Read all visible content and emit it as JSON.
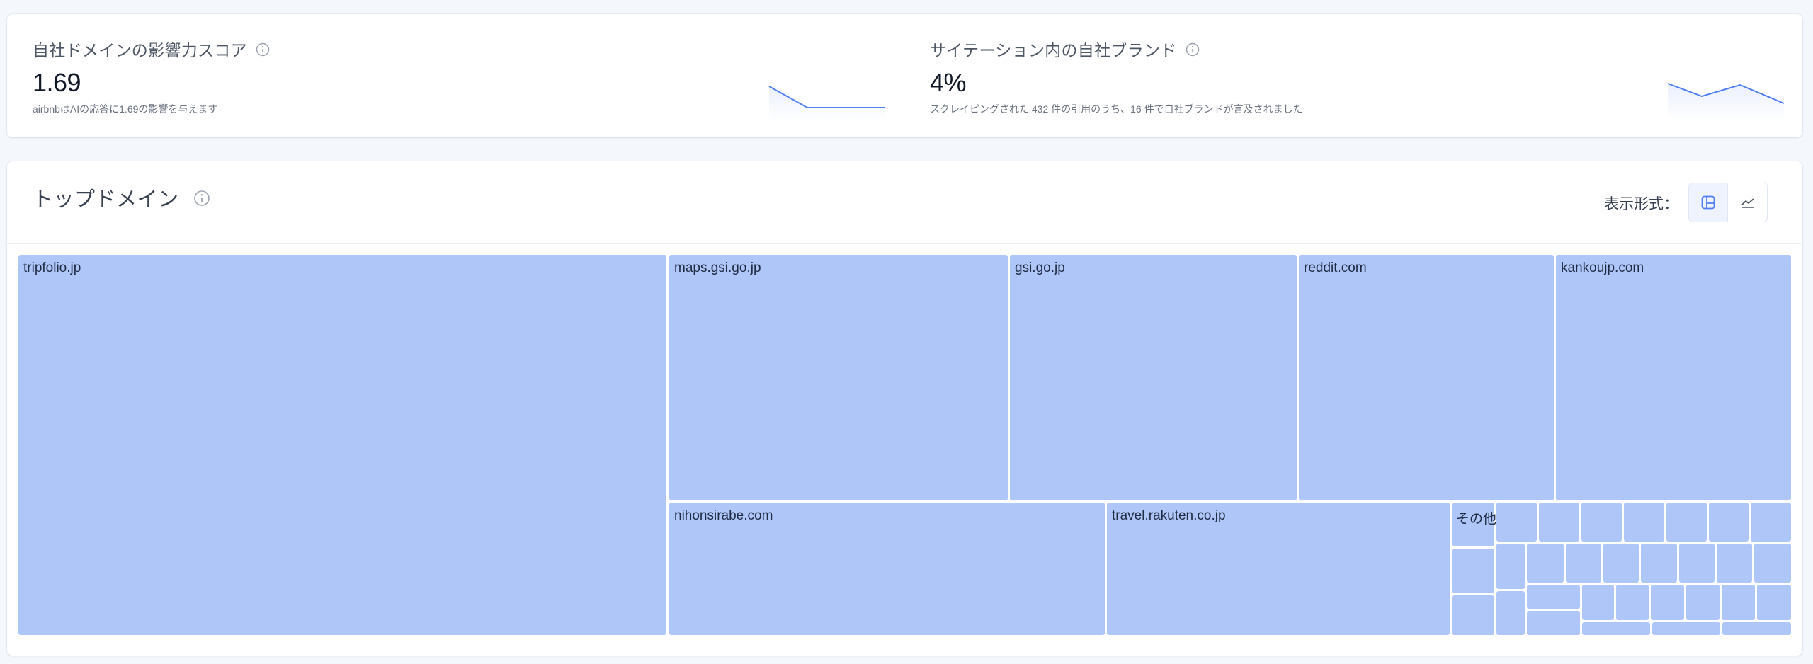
{
  "stats": [
    {
      "title": "自社ドメインの影響力スコア",
      "value": "1.69",
      "description": "airbnbはAIの応答に1.69の影響を与えます",
      "sparkline_color": "#4f7ff0"
    },
    {
      "title": "サイテーション内の自社ブランド",
      "value": "4%",
      "description": "スクレイピングされた 432 件の引用のうち、16 件で自社ブランドが言及されました",
      "sparkline_color": "#4f7ff0"
    }
  ],
  "domains": {
    "title": "トップドメイン",
    "view_label": "表示形式：",
    "view_modes": [
      {
        "name": "treemap-view",
        "icon": "treemap-icon",
        "active": true
      },
      {
        "name": "line-chart-view",
        "icon": "line-chart-icon",
        "active": false
      }
    ],
    "tile_color": "#afc6f8",
    "tiles": [
      {
        "label": "tripfolio.jp"
      },
      {
        "label": "maps.gsi.go.jp"
      },
      {
        "label": "gsi.go.jp"
      },
      {
        "label": "reddit.com"
      },
      {
        "label": "kankoujp.com"
      },
      {
        "label": "nihonsirabe.com"
      },
      {
        "label": "travel.rakuten.co.jp"
      },
      {
        "label": "その他"
      }
    ]
  }
}
